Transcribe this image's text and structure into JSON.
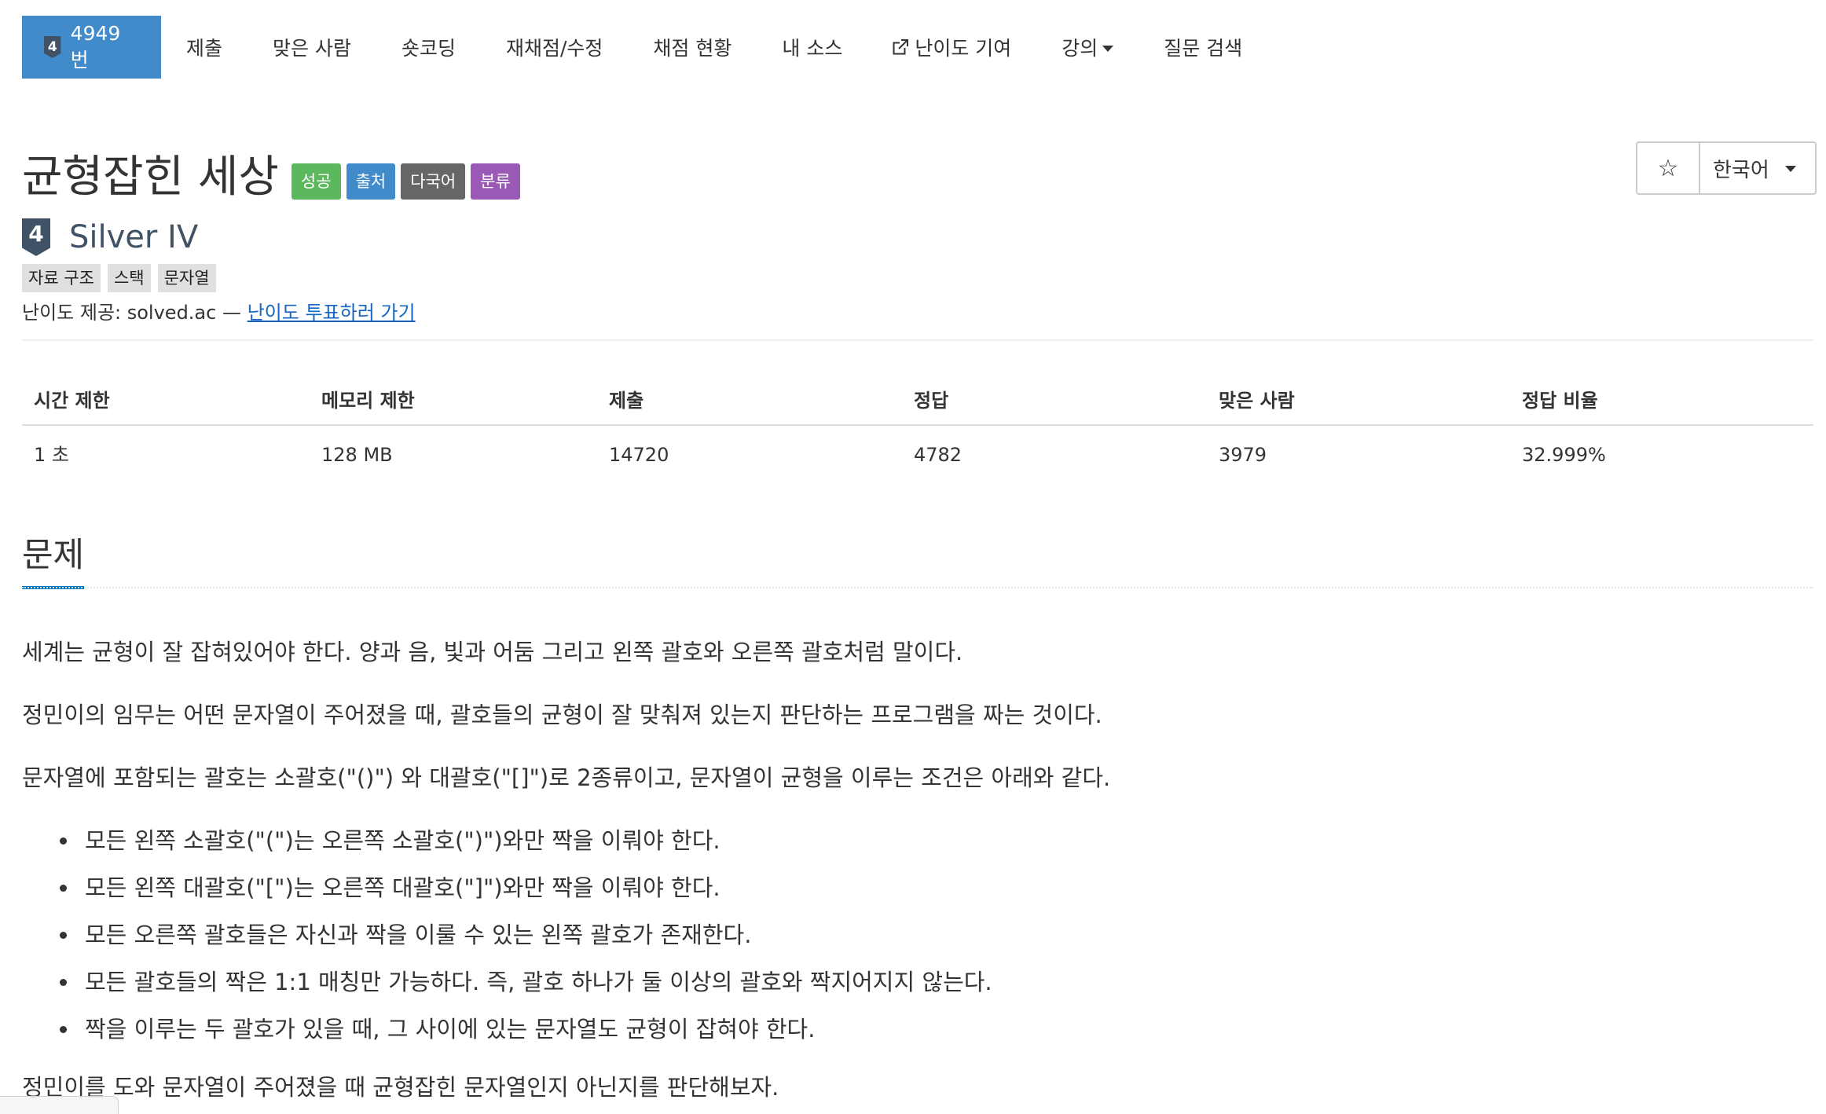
{
  "nav": {
    "active": {
      "tier_digit": "4",
      "label": "4949번"
    },
    "items": [
      "제출",
      "맞은 사람",
      "숏코딩",
      "재채점/수정",
      "채점 현황",
      "내 소스",
      "난이도 기여",
      "강의",
      "질문 검색"
    ]
  },
  "problem": {
    "title": "균형잡힌 세상",
    "labels": [
      "성공",
      "출처",
      "다국어",
      "분류"
    ],
    "tier_digit": "4",
    "tier": "Silver IV",
    "tags": [
      "자료 구조",
      "스택",
      "문자열"
    ],
    "credit_prefix": "난이도 제공: solved.ac — ",
    "credit_link": "난이도 투표하러 가기"
  },
  "controls": {
    "star": "☆",
    "language": "한국어"
  },
  "stats": {
    "headers": [
      "시간 제한",
      "메모리 제한",
      "제출",
      "정답",
      "맞은 사람",
      "정답 비율"
    ],
    "values": [
      "1 초",
      "128 MB",
      "14720",
      "4782",
      "3979",
      "32.999%"
    ]
  },
  "section": {
    "heading": "문제",
    "paragraphs": [
      "세계는 균형이 잘 잡혀있어야 한다. 양과 음, 빛과 어둠 그리고 왼쪽 괄호와 오른쪽 괄호처럼 말이다.",
      "정민이의 임무는 어떤 문자열이 주어졌을 때, 괄호들의 균형이 잘 맞춰져 있는지 판단하는 프로그램을 짜는 것이다.",
      "문자열에 포함되는 괄호는 소괄호(\"()\") 와 대괄호(\"[]\")로 2종류이고, 문자열이 균형을 이루는 조건은 아래와 같다."
    ],
    "rules": [
      "모든 왼쪽 소괄호(\"(\")는 오른쪽 소괄호(\")\")와만 짝을 이뤄야 한다.",
      "모든 왼쪽 대괄호(\"[\")는 오른쪽 대괄호(\"]\")와만 짝을 이뤄야 한다.",
      "모든 오른쪽 괄호들은 자신과 짝을 이룰 수 있는 왼쪽 괄호가 존재한다.",
      "모든 괄호들의 짝은 1:1 매칭만 가능하다. 즉, 괄호 하나가 둘 이상의 괄호와 짝지어지지 않는다.",
      "짝을 이루는 두 괄호가 있을 때, 그 사이에 있는 문자열도 균형이 잡혀야 한다."
    ],
    "closing": "정민이를 도와 문자열이 주어졌을 때 균형잡힌 문자열인지 아닌지를 판단해보자."
  }
}
